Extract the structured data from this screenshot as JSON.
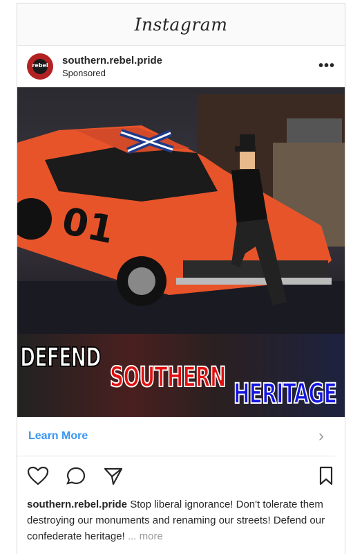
{
  "app": {
    "title": "Instagram"
  },
  "post": {
    "username": "southern.rebel.pride",
    "sponsored": "Sponsored",
    "avatar_text": "rebel",
    "more_label": "•••",
    "banner": {
      "line1": "DEFEND",
      "line2": "SOUTHERN",
      "line3": "HERITAGE"
    },
    "car_number": "01",
    "cta_label": "Learn More",
    "cta_chevron": "›",
    "caption_user": "southern.rebel.pride",
    "caption_text": " Stop liberal ignorance! Don't tolerate them destroying our monuments and renaming our streets! Defend our confederate heritage!",
    "caption_more": " ... more"
  },
  "icons": [
    "heart-icon",
    "comment-icon",
    "share-icon",
    "bookmark-icon"
  ],
  "colors": {
    "link": "#3897f0",
    "red_text": "#e01010",
    "blue_text": "#1414e0"
  }
}
